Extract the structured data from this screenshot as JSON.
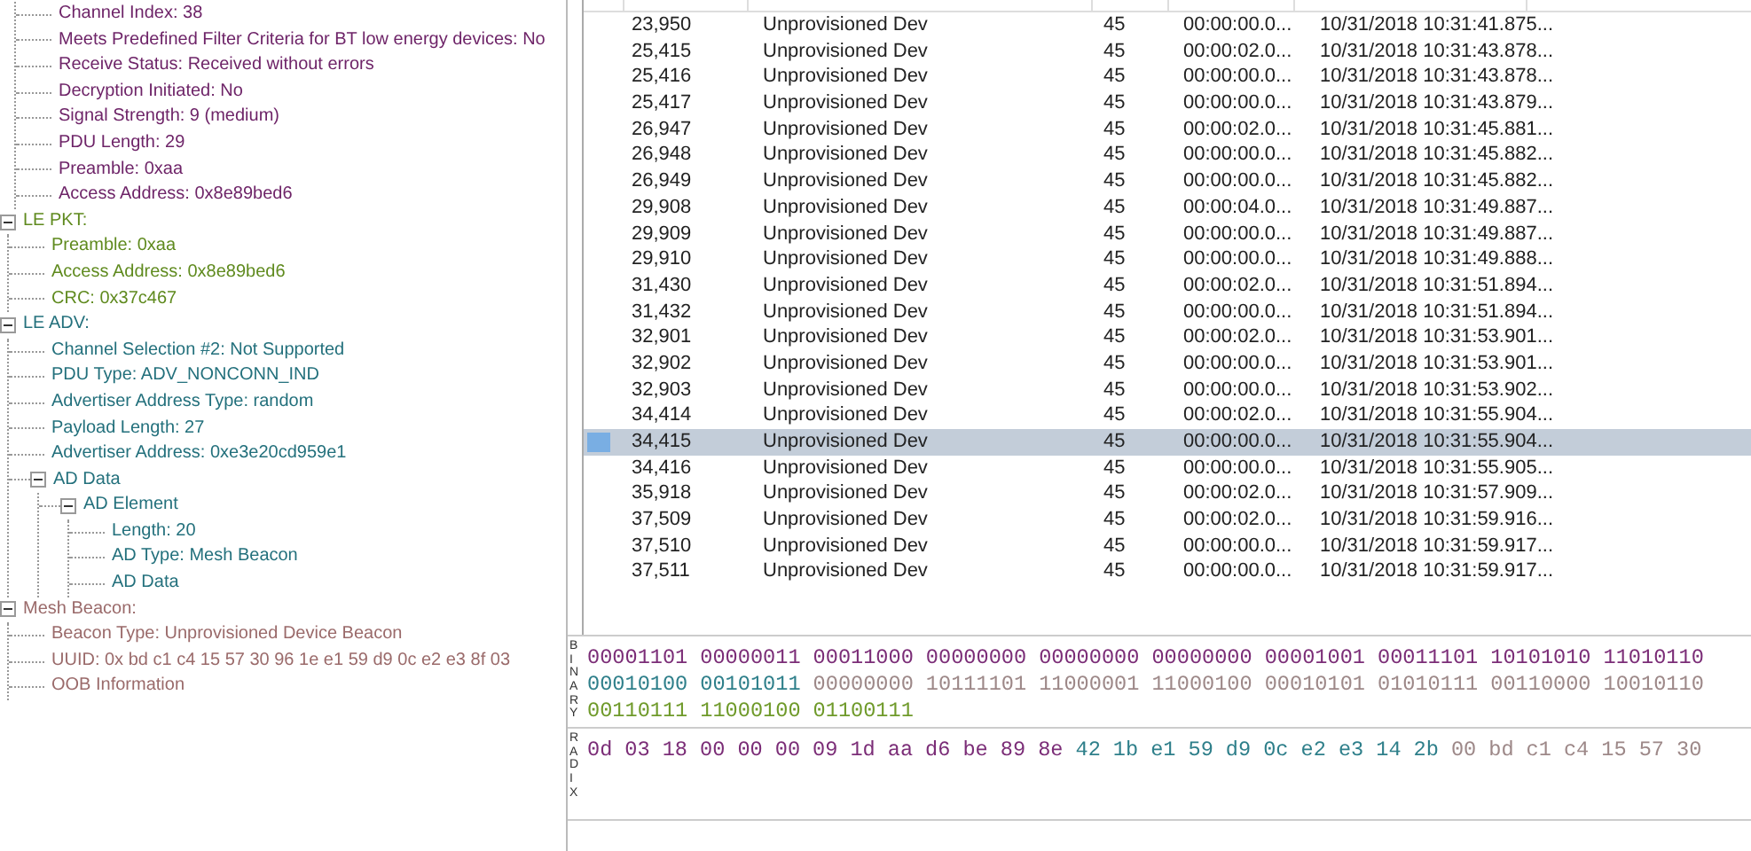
{
  "tree": [
    {
      "color": "#6e2468",
      "expanded": true,
      "children": [
        {
          "label": "Channel Index: 38"
        },
        {
          "label": "Meets Predefined Filter Criteria for BT low energy devices: No"
        },
        {
          "label": "Receive Status: Received without errors"
        },
        {
          "label": "Decryption Initiated: No"
        },
        {
          "label": "Signal Strength: 9 (medium)"
        },
        {
          "label": "PDU Length: 29"
        },
        {
          "label": "Preamble: 0xaa"
        },
        {
          "label": "Access Address: 0x8e89bed6"
        }
      ]
    },
    {
      "label": "LE PKT:",
      "color": "#5f8a1e",
      "expanded": true,
      "children": [
        {
          "label": "Preamble: 0xaa"
        },
        {
          "label": "Access Address: 0x8e89bed6"
        },
        {
          "label": "CRC: 0x37c467"
        }
      ]
    },
    {
      "label": "LE ADV:",
      "color": "#23707c",
      "expanded": true,
      "children": [
        {
          "label": "Channel Selection #2: Not Supported"
        },
        {
          "label": "PDU Type: ADV_NONCONN_IND"
        },
        {
          "label": "Advertiser Address Type: random"
        },
        {
          "label": "Payload Length: 27"
        },
        {
          "label": "Advertiser Address: 0xe3e20cd959e1"
        },
        {
          "label": "AD Data",
          "expanded": true,
          "children": [
            {
              "label": "AD Element",
              "expanded": true,
              "children": [
                {
                  "label": "Length: 20"
                },
                {
                  "label": "AD Type: Mesh Beacon"
                },
                {
                  "label": "AD Data"
                }
              ]
            }
          ]
        }
      ]
    },
    {
      "label": "Mesh Beacon:",
      "color": "#9a6a6a",
      "expanded": true,
      "children": [
        {
          "label": "Beacon Type: Unprovisioned Device Beacon"
        },
        {
          "label": "UUID: 0x bd c1 c4 15 57 30 96 1e e1 59 d9 0c e2 e3 8f 03"
        },
        {
          "label": "OOB Information"
        }
      ]
    }
  ],
  "table": {
    "rows": [
      {
        "cells": [
          "23,950",
          "Unprovisioned Dev",
          "45",
          "00:00:00.0...",
          "10/31/2018 10:31:41.875..."
        ],
        "selected": false
      },
      {
        "cells": [
          "25,415",
          "Unprovisioned Dev",
          "45",
          "00:00:02.0...",
          "10/31/2018 10:31:43.878..."
        ],
        "selected": false
      },
      {
        "cells": [
          "25,416",
          "Unprovisioned Dev",
          "45",
          "00:00:00.0...",
          "10/31/2018 10:31:43.878..."
        ],
        "selected": false
      },
      {
        "cells": [
          "25,417",
          "Unprovisioned Dev",
          "45",
          "00:00:00.0...",
          "10/31/2018 10:31:43.879..."
        ],
        "selected": false
      },
      {
        "cells": [
          "26,947",
          "Unprovisioned Dev",
          "45",
          "00:00:02.0...",
          "10/31/2018 10:31:45.881..."
        ],
        "selected": false
      },
      {
        "cells": [
          "26,948",
          "Unprovisioned Dev",
          "45",
          "00:00:00.0...",
          "10/31/2018 10:31:45.882..."
        ],
        "selected": false
      },
      {
        "cells": [
          "26,949",
          "Unprovisioned Dev",
          "45",
          "00:00:00.0...",
          "10/31/2018 10:31:45.882..."
        ],
        "selected": false
      },
      {
        "cells": [
          "29,908",
          "Unprovisioned Dev",
          "45",
          "00:00:04.0...",
          "10/31/2018 10:31:49.887..."
        ],
        "selected": false
      },
      {
        "cells": [
          "29,909",
          "Unprovisioned Dev",
          "45",
          "00:00:00.0...",
          "10/31/2018 10:31:49.887..."
        ],
        "selected": false
      },
      {
        "cells": [
          "29,910",
          "Unprovisioned Dev",
          "45",
          "00:00:00.0...",
          "10/31/2018 10:31:49.888..."
        ],
        "selected": false
      },
      {
        "cells": [
          "31,430",
          "Unprovisioned Dev",
          "45",
          "00:00:02.0...",
          "10/31/2018 10:31:51.894..."
        ],
        "selected": false
      },
      {
        "cells": [
          "31,432",
          "Unprovisioned Dev",
          "45",
          "00:00:00.0...",
          "10/31/2018 10:31:51.894..."
        ],
        "selected": false
      },
      {
        "cells": [
          "32,901",
          "Unprovisioned Dev",
          "45",
          "00:00:02.0...",
          "10/31/2018 10:31:53.901..."
        ],
        "selected": false
      },
      {
        "cells": [
          "32,902",
          "Unprovisioned Dev",
          "45",
          "00:00:00.0...",
          "10/31/2018 10:31:53.901..."
        ],
        "selected": false
      },
      {
        "cells": [
          "32,903",
          "Unprovisioned Dev",
          "45",
          "00:00:00.0...",
          "10/31/2018 10:31:53.902..."
        ],
        "selected": false
      },
      {
        "cells": [
          "34,414",
          "Unprovisioned Dev",
          "45",
          "00:00:02.0...",
          "10/31/2018 10:31:55.904..."
        ],
        "selected": false
      },
      {
        "cells": [
          "34,415",
          "Unprovisioned Dev",
          "45",
          "00:00:00.0...",
          "10/31/2018 10:31:55.904..."
        ],
        "selected": true
      },
      {
        "cells": [
          "34,416",
          "Unprovisioned Dev",
          "45",
          "00:00:00.0...",
          "10/31/2018 10:31:55.905..."
        ],
        "selected": false
      },
      {
        "cells": [
          "35,918",
          "Unprovisioned Dev",
          "45",
          "00:00:02.0...",
          "10/31/2018 10:31:57.909..."
        ],
        "selected": false
      },
      {
        "cells": [
          "37,509",
          "Unprovisioned Dev",
          "45",
          "00:00:02.0...",
          "10/31/2018 10:31:59.916..."
        ],
        "selected": false
      },
      {
        "cells": [
          "37,510",
          "Unprovisioned Dev",
          "45",
          "00:00:00.0...",
          "10/31/2018 10:31:59.917..."
        ],
        "selected": false
      },
      {
        "cells": [
          "37,511",
          "Unprovisioned Dev",
          "45",
          "00:00:00.0...",
          "10/31/2018 10:31:59.917..."
        ],
        "selected": false
      }
    ]
  },
  "binary_panel": {
    "label": "BINARY",
    "rows": [
      [
        {
          "color": "#7b2d77",
          "bytes": [
            "00001101",
            "00000011",
            "00011000",
            "00000000",
            "00000000",
            "00000000",
            "00001001",
            "00011101",
            "10101010",
            "11010110"
          ]
        }
      ],
      [
        {
          "color": "#2e7f8a",
          "bytes": [
            "00010100",
            "00101011"
          ]
        },
        {
          "color": "#9d8888",
          "bytes": [
            "00000000",
            "10111101",
            "11000001",
            "11000100",
            "00010101",
            "01010111",
            "00110000",
            "10010110"
          ]
        }
      ],
      [
        {
          "color": "#6f9a2a",
          "bytes": [
            "00110111",
            "11000100",
            "01100111"
          ]
        }
      ]
    ]
  },
  "radix_panel": {
    "label": "RADIX",
    "rows": [
      [
        {
          "color": "#7b2d77",
          "bytes": [
            "0d",
            "03",
            "18",
            "00",
            "00",
            "00",
            "09",
            "1d",
            "aa",
            "d6",
            "be",
            "89",
            "8e"
          ]
        },
        {
          "color": "#2e7f8a",
          "bytes": [
            "42",
            "1b",
            "e1",
            "59",
            "d9",
            "0c",
            "e2",
            "e3",
            "14",
            "2b"
          ]
        },
        {
          "color": "#9d8888",
          "bytes": [
            "00",
            "bd",
            "c1",
            "c4",
            "15",
            "57",
            "30"
          ]
        }
      ]
    ]
  }
}
